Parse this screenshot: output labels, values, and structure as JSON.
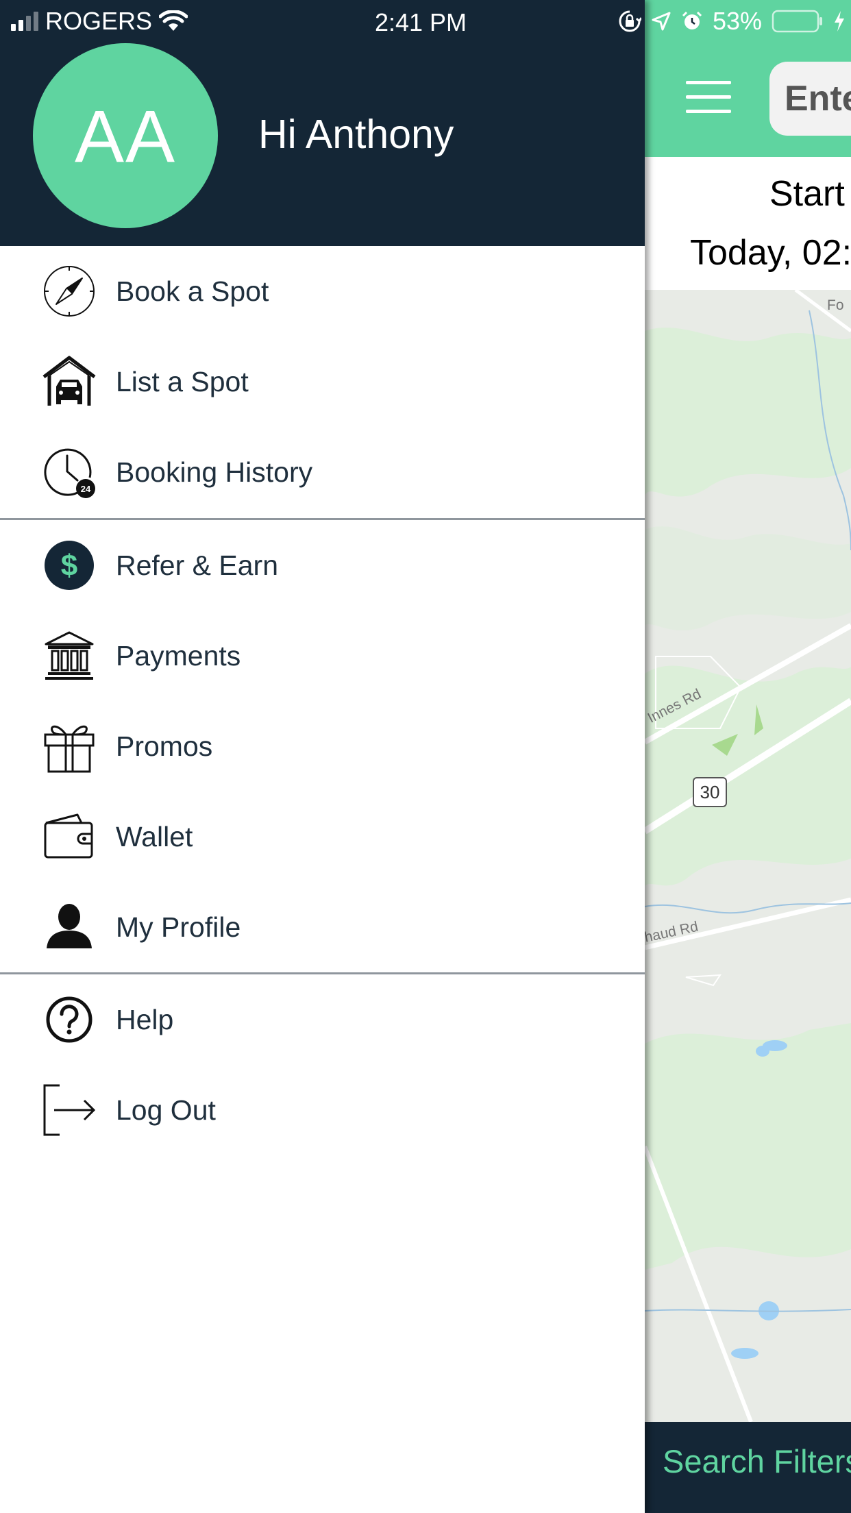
{
  "status_bar": {
    "carrier": "ROGERS",
    "time": "2:41 PM",
    "battery_percent": "53%",
    "battery_level": 0.53,
    "icons": [
      "signal-icon",
      "wifi-icon",
      "orientation-lock-icon",
      "location-arrow-icon",
      "alarm-icon",
      "battery-icon",
      "charging-icon"
    ]
  },
  "drawer": {
    "avatar_initials": "AA",
    "greeting": "Hi Anthony",
    "items": [
      {
        "label": "Book a Spot",
        "icon": "compass-icon"
      },
      {
        "label": "List a Spot",
        "icon": "garage-car-icon"
      },
      {
        "label": "Booking History",
        "icon": "clock-24-icon"
      },
      {
        "label": "Refer & Earn",
        "icon": "dollar-circle-icon"
      },
      {
        "label": "Payments",
        "icon": "bank-icon"
      },
      {
        "label": "Promos",
        "icon": "gift-icon"
      },
      {
        "label": "Wallet",
        "icon": "wallet-icon"
      },
      {
        "label": "My Profile",
        "icon": "person-icon"
      },
      {
        "label": "Help",
        "icon": "help-circle-icon"
      },
      {
        "label": "Log Out",
        "icon": "logout-icon"
      }
    ],
    "colors": {
      "header_bg": "#142636",
      "accent": "#5fd4a0",
      "text": "#1f2f3d",
      "divider": "#8f969d"
    }
  },
  "main": {
    "search_placeholder": "Ente",
    "start_label": "Start",
    "start_value": "Today, 02:",
    "map": {
      "labels": [
        "Fo",
        "Innes Rd",
        "haud Rd"
      ],
      "route_shield": "30"
    },
    "filters_label": "Search Filters"
  }
}
